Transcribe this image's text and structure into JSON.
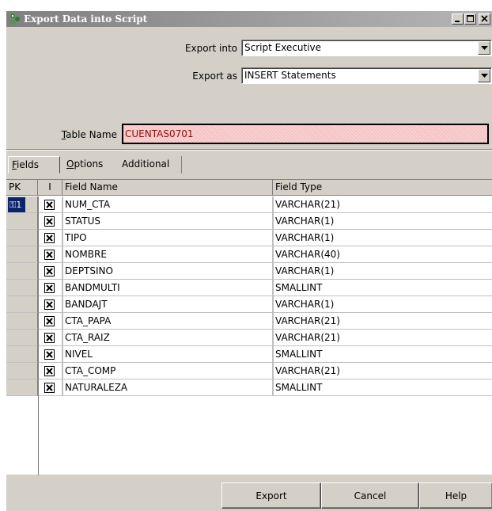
{
  "window": {
    "title": "Export Data into Script",
    "icon": "export-script-icon"
  },
  "form": {
    "export_into_label": "Export into",
    "export_into_value": "Script Executive",
    "export_as_label": "Export as",
    "export_as_value": "INSERT Statements",
    "table_name_label_prefix": "",
    "table_name_label_underline": "T",
    "table_name_label_rest": "able Name",
    "table_name_value": "CUENTAS0701"
  },
  "tabs": [
    {
      "underline": "F",
      "rest": "ields"
    },
    {
      "underline": "O",
      "rest": "ptions"
    },
    {
      "underline": "",
      "rest": "Additional"
    }
  ],
  "grid": {
    "columns": [
      "PK",
      "I",
      "Field Name",
      "Field Type"
    ],
    "rows": [
      {
        "pk": "1",
        "name": "NUM_CTA",
        "type": "VARCHAR(21)"
      },
      {
        "pk": "",
        "name": "STATUS",
        "type": "VARCHAR(1)"
      },
      {
        "pk": "",
        "name": "TIPO",
        "type": "VARCHAR(1)"
      },
      {
        "pk": "",
        "name": "NOMBRE",
        "type": "VARCHAR(40)"
      },
      {
        "pk": "",
        "name": "DEPTSINO",
        "type": "VARCHAR(1)"
      },
      {
        "pk": "",
        "name": "BANDMULTI",
        "type": "SMALLINT"
      },
      {
        "pk": "",
        "name": "BANDAJT",
        "type": "VARCHAR(1)"
      },
      {
        "pk": "",
        "name": "CTA_PAPA",
        "type": "VARCHAR(21)"
      },
      {
        "pk": "",
        "name": "CTA_RAIZ",
        "type": "VARCHAR(21)"
      },
      {
        "pk": "",
        "name": "NIVEL",
        "type": "SMALLINT"
      },
      {
        "pk": "",
        "name": "CTA_COMP",
        "type": "VARCHAR(21)"
      },
      {
        "pk": "",
        "name": "NATURALEZA",
        "type": "SMALLINT"
      }
    ]
  },
  "buttons": {
    "export": "Export",
    "cancel": "Cancel",
    "help": "Help"
  },
  "colors": {
    "table_name_bg": "#f6c3c3",
    "table_name_text": "#8b1010",
    "pk_highlight": "#0a246a"
  }
}
